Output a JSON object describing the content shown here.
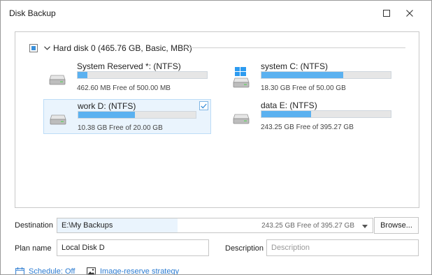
{
  "window": {
    "title": "Disk Backup"
  },
  "disk": {
    "title": "Hard disk 0 (465.76 GB, Basic, MBR)",
    "partitions": [
      {
        "name": "System Reserved *: (NTFS)",
        "free": "462.60 MB Free of 500.00 MB",
        "used_fraction": 0.075,
        "icon": "hdd-icon",
        "selected": false
      },
      {
        "name": "system C: (NTFS)",
        "free": "18.30 GB Free of 50.00 GB",
        "used_fraction": 0.634,
        "icon": "windows-drive-icon",
        "selected": false
      },
      {
        "name": "work D: (NTFS)",
        "free": "10.38 GB Free of 20.00 GB",
        "used_fraction": 0.481,
        "icon": "hdd-icon",
        "selected": true
      },
      {
        "name": "data E: (NTFS)",
        "free": "243.25 GB Free of 395.27 GB",
        "used_fraction": 0.385,
        "icon": "hdd-icon",
        "selected": false
      }
    ]
  },
  "destination": {
    "label": "Destination",
    "path": "E:\\My Backups",
    "free": "243.25 GB Free of 395.27 GB",
    "browse": "Browse..."
  },
  "plan": {
    "label": "Plan name",
    "value": "Local Disk D"
  },
  "description": {
    "label": "Description",
    "placeholder": "Description"
  },
  "links": {
    "schedule": "Schedule: Off",
    "strategy": "Image-reserve strategy"
  },
  "colors": {
    "accent": "#3a8fd9",
    "bar_fill": "#5bb1f0",
    "selected_bg": "#eaf4fd",
    "link": "#2b7bd1"
  }
}
